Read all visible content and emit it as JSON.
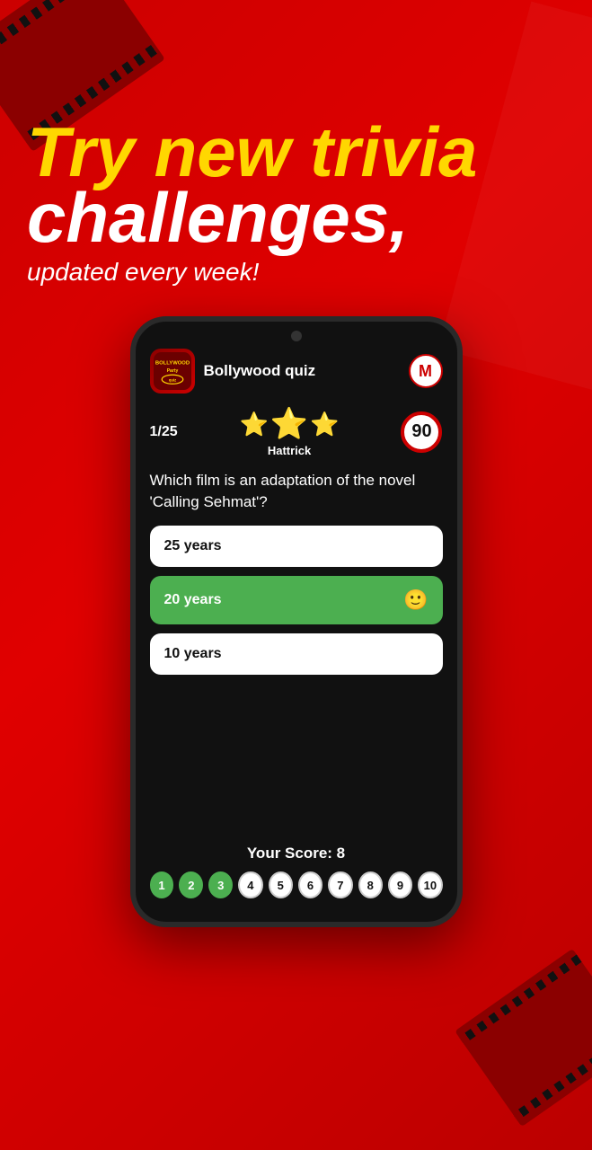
{
  "background": {
    "color": "#cc0000"
  },
  "headline": {
    "line1": "Try new trivia",
    "line2": "challenges,",
    "sub": "updated every week!"
  },
  "phone": {
    "quiz_title": "Bollywood quiz",
    "avatar_initial": "M",
    "question_counter": "1/25",
    "hattrick_label": "Hattrick",
    "timer_value": "90",
    "question_text": "Which film is an adaptation of the novel 'Calling Sehmat'?",
    "answers": [
      {
        "label": "25 years",
        "state": "default"
      },
      {
        "label": "20 years",
        "state": "correct"
      },
      {
        "label": "10 years",
        "state": "default"
      }
    ],
    "your_score_label": "Your Score: 8",
    "progress_dots": [
      {
        "number": "1",
        "state": "green"
      },
      {
        "number": "2",
        "state": "green"
      },
      {
        "number": "3",
        "state": "green"
      },
      {
        "number": "4",
        "state": "white"
      },
      {
        "number": "5",
        "state": "white"
      },
      {
        "number": "6",
        "state": "white"
      },
      {
        "number": "7",
        "state": "white"
      },
      {
        "number": "8",
        "state": "white"
      },
      {
        "number": "9",
        "state": "white"
      },
      {
        "number": "10",
        "state": "white"
      }
    ]
  }
}
